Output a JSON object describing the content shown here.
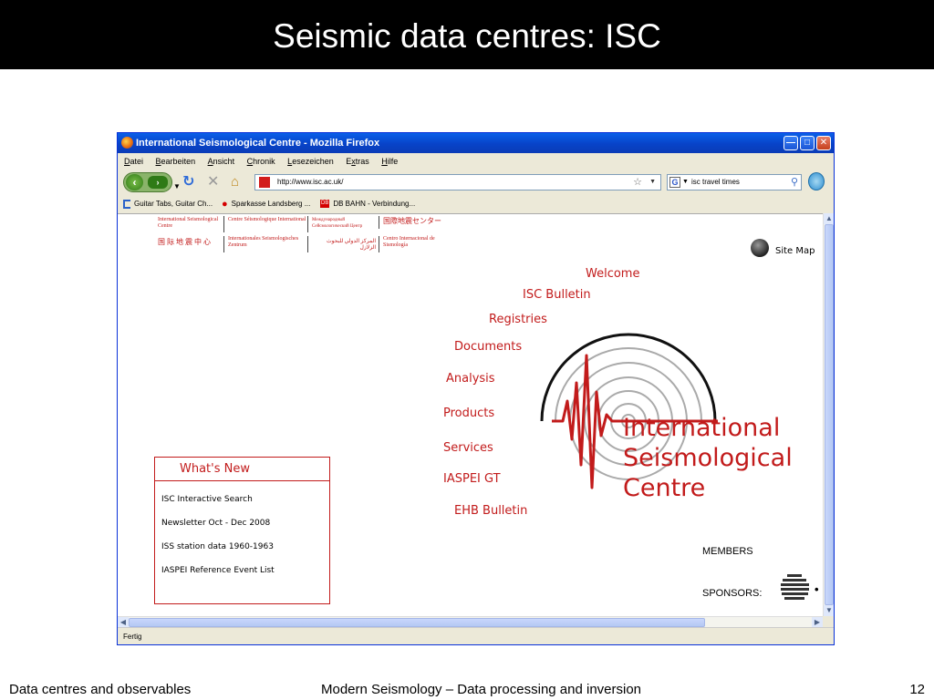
{
  "slide": {
    "title": "Seismic data centres: ISC",
    "footer_left": "Data centres and observables",
    "footer_center": "Modern Seismology – Data processing and inversion",
    "page_number": "12"
  },
  "browser": {
    "window_title": "International Seismological Centre - Mozilla Firefox",
    "menu": [
      "Datei",
      "Bearbeiten",
      "Ansicht",
      "Chronik",
      "Lesezeichen",
      "Extras",
      "Hilfe"
    ],
    "menu_underline": [
      "D",
      "B",
      "A",
      "C",
      "L",
      "x",
      "H"
    ],
    "url": "http://www.isc.ac.uk/",
    "search_value": "isc travel times",
    "bookmarks": [
      "Guitar Tabs, Guitar Ch...",
      "Sparkasse Landsberg ...",
      "DB BAHN - Verbindung..."
    ],
    "bookmark_badge": "DB",
    "status": "Fertig"
  },
  "page": {
    "languages": {
      "en": "International Seismological Centre",
      "fr": "Centre Séismologique International",
      "ru": "Международный Сейсмологический Центр",
      "ja": "国際地震センター",
      "zh": "国 际 地 震 中 心",
      "de": "Internationales Seismologisches Zentrum",
      "ar": "المركز الدولي للبحوث الزلازل",
      "es": "Centro Internacional de Sismología"
    },
    "site_map": "Site Map",
    "nav": [
      "Welcome",
      "ISC Bulletin",
      "Registries",
      "Documents",
      "Analysis",
      "Products",
      "Services",
      "IASPEI GT",
      "EHB Bulletin"
    ],
    "whats_new": {
      "title": "What's New",
      "items": [
        "ISC Interactive Search",
        "Newsletter Oct - Dec 2008",
        "ISS station data 1960-1963",
        "IASPEI Reference Event List"
      ]
    },
    "logo_text": [
      "International",
      "Seismological",
      "Centre"
    ],
    "members": "MEMBERS",
    "sponsors": "SPONSORS:"
  },
  "colors": {
    "isc_red": "#c21b1b",
    "title_bar": "#000000",
    "xp_blue": "#0a5fe8"
  }
}
